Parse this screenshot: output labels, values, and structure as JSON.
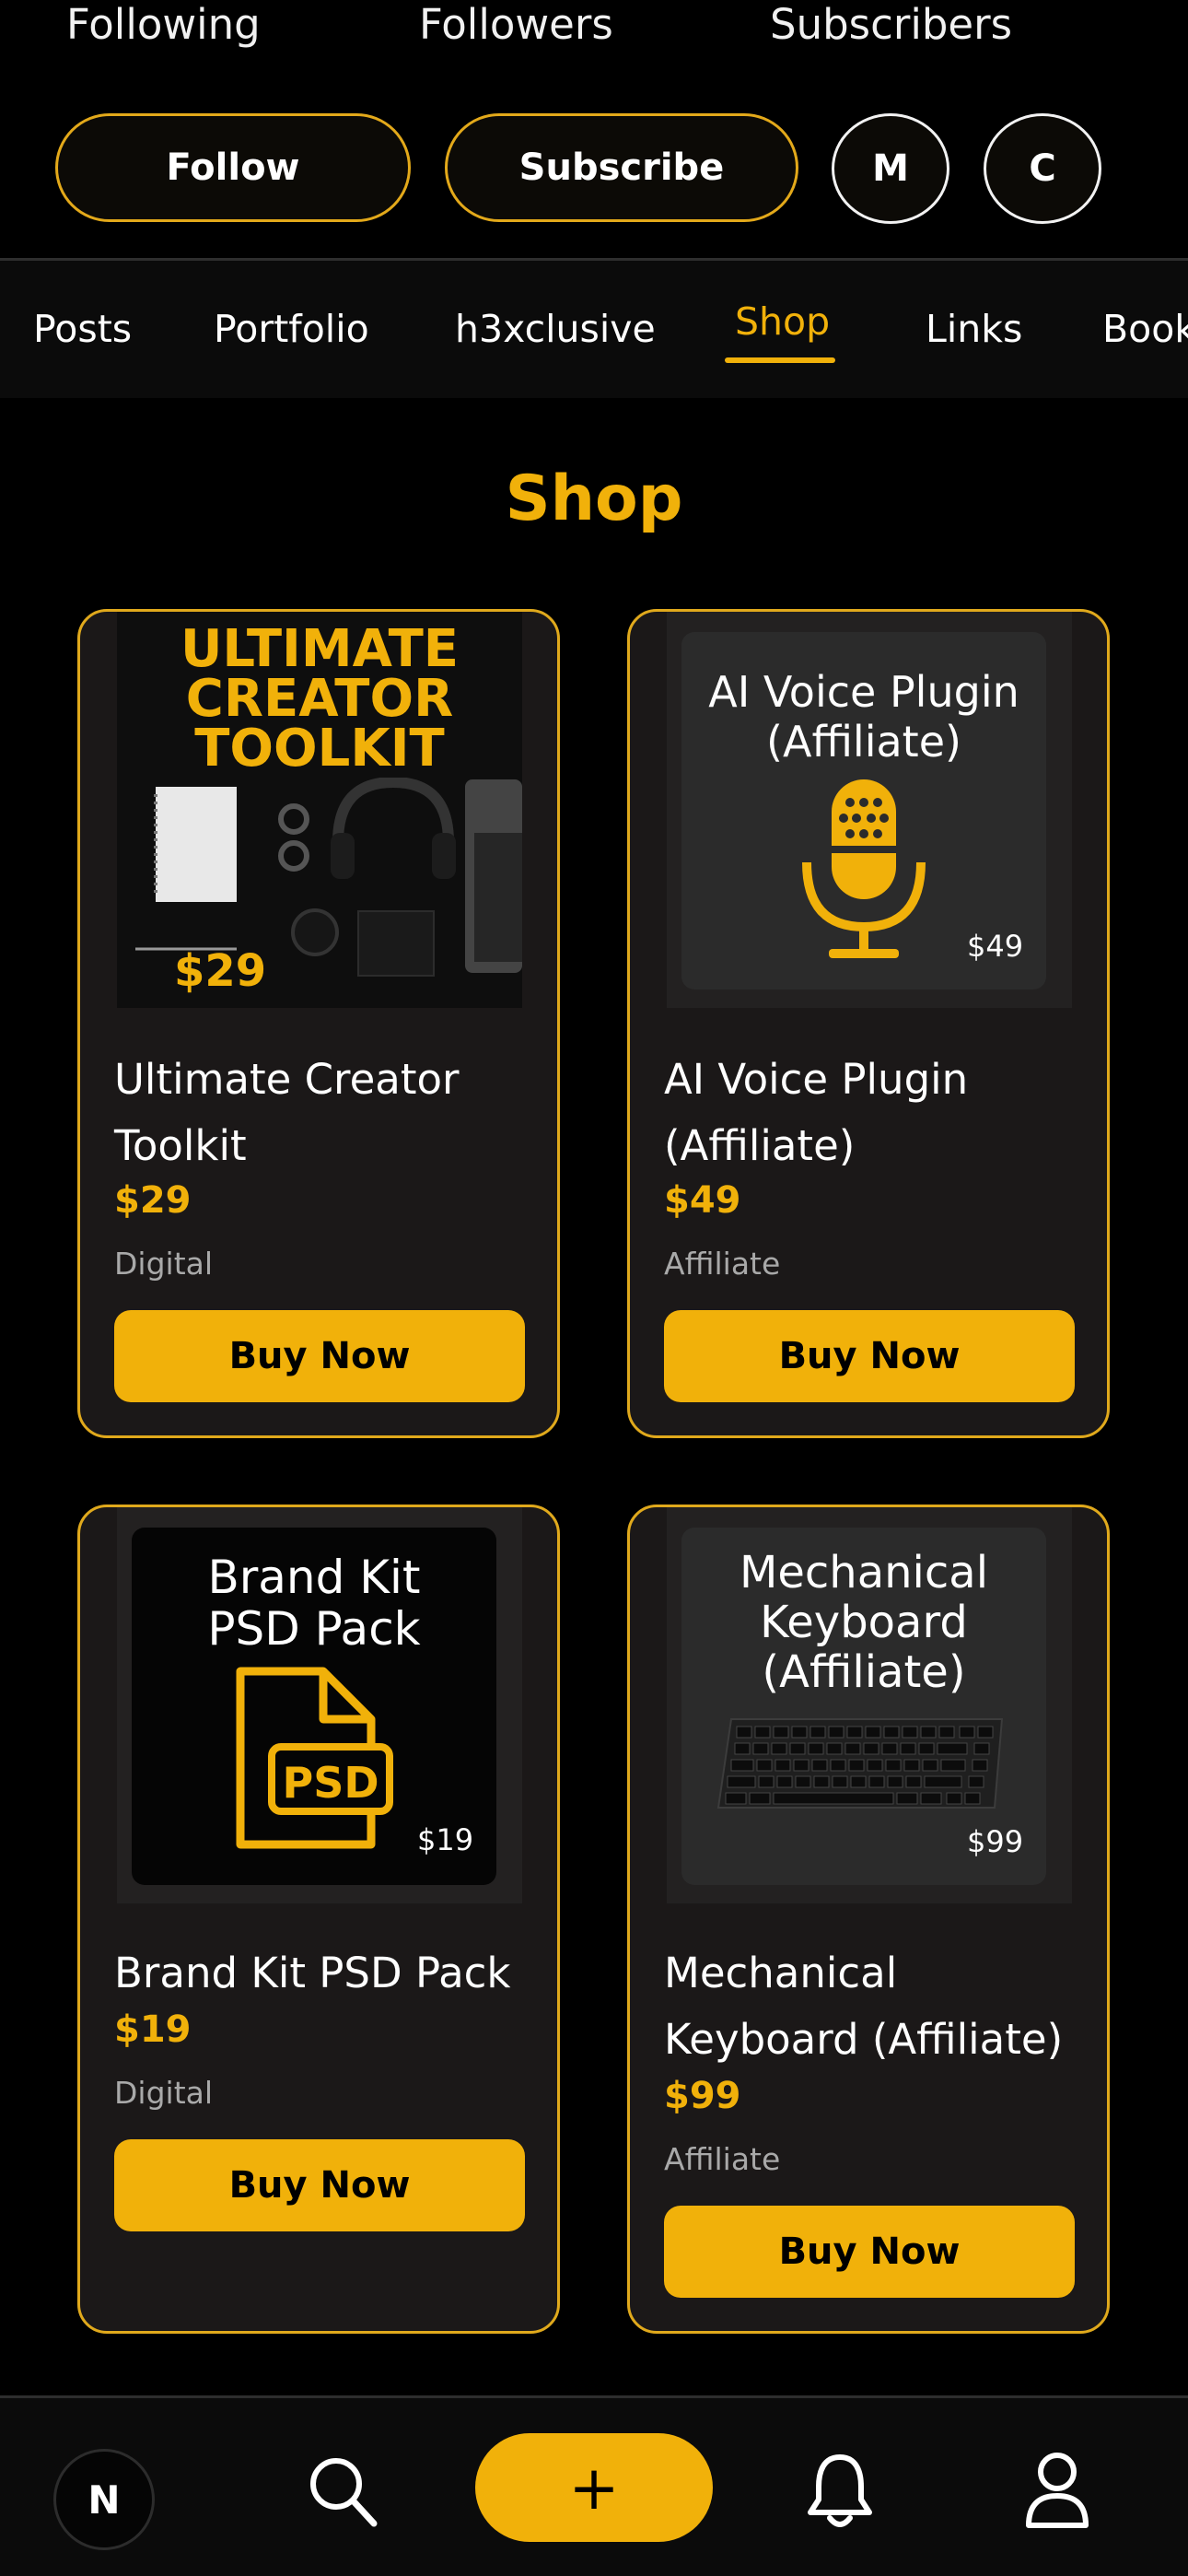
{
  "stats": {
    "following": "Following",
    "followers": "Followers",
    "subscribers": "Subscribers"
  },
  "actions": {
    "follow": "Follow",
    "subscribe": "Subscribe",
    "m": "M",
    "c": "C"
  },
  "tabs": [
    "Posts",
    "Portfolio",
    "h3xclusive",
    "Shop",
    "Links",
    "Book"
  ],
  "active_tab": "Shop",
  "shop_title": "Shop",
  "products": [
    {
      "name": "Ultimate Creator Toolkit",
      "price": "$29",
      "category": "Digital",
      "buy_label": "Buy Now",
      "image_text": [
        "ULTIMATE",
        "CREATOR",
        "TOOLKIT"
      ],
      "image_price": "$29"
    },
    {
      "name": "AI Voice Plugin (Affiliate)",
      "price": "$49",
      "category": "Affiliate",
      "buy_label": "Buy Now",
      "image_text": [
        "AI Voice Plugin",
        "(Affiliate)"
      ],
      "image_price": "$49"
    },
    {
      "name": "Brand Kit PSD Pack",
      "price": "$19",
      "category": "Digital",
      "buy_label": "Buy Now",
      "image_text": [
        "Brand Kit",
        "PSD Pack"
      ],
      "image_badge": "PSD",
      "image_price": "$19"
    },
    {
      "name": "Mechanical Keyboard (Affiliate)",
      "price": "$99",
      "category": "Affiliate",
      "buy_label": "Buy Now",
      "image_text": [
        "Mechanical",
        "Keyboard",
        "(Affiliate)"
      ],
      "image_price": "$99"
    }
  ],
  "bottom_nav": {
    "avatar_letter": "N",
    "add_label": "+"
  },
  "colors": {
    "accent": "#f1b10a",
    "card_border": "#e0a91c",
    "background": "#000000"
  }
}
